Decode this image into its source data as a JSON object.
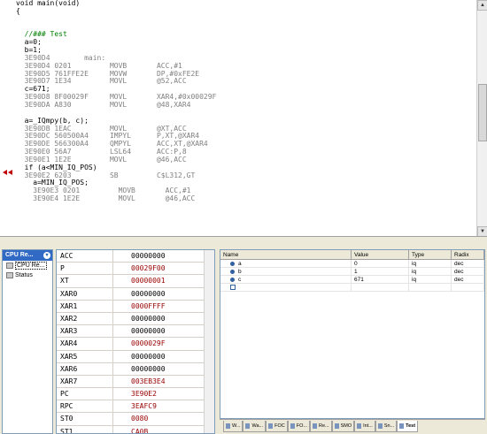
{
  "code_lines": [
    {
      "text": "void main(void)",
      "cls": "c-src"
    },
    {
      "text": "{",
      "cls": "c-src"
    },
    {
      "text": "",
      "cls": "c-src"
    },
    {
      "text": "",
      "cls": "c-src"
    },
    {
      "text": "  //### Test",
      "cls": "c-comment"
    },
    {
      "text": "  a=0;",
      "cls": "c-src"
    },
    {
      "text": "  b=1;",
      "cls": "c-src"
    },
    {
      "text": "  3E90D4        main:",
      "cls": "c-asm"
    },
    {
      "text": "  3E90D4 0201         MOVB       ACC,#1",
      "cls": "c-asm"
    },
    {
      "text": "  3E90D5 761FFE2E     MOVW       DP,#0xFE2E",
      "cls": "c-asm"
    },
    {
      "text": "  3E90D7 1E34         MOVL       @52,ACC",
      "cls": "c-asm"
    },
    {
      "text": "  c=671;",
      "cls": "c-src"
    },
    {
      "text": "  3E90D8 8F00029F     MOVL       XAR4,#0x00029F",
      "cls": "c-asm"
    },
    {
      "text": "  3E90DA A830         MOVL       @48,XAR4",
      "cls": "c-asm"
    },
    {
      "text": "",
      "cls": "c-src"
    },
    {
      "text": "  a=_IQmpy(b, c);",
      "cls": "c-src"
    },
    {
      "text": "  3E90DB 1EAC         MOVL       @XT,ACC",
      "cls": "c-asm"
    },
    {
      "text": "  3E90DC 560500A4     IMPYL      P,XT,@XAR4",
      "cls": "c-asm"
    },
    {
      "text": "  3E90DE 566300A4     QMPYL      ACC,XT,@XAR4",
      "cls": "c-asm"
    },
    {
      "text": "  3E90E0 56A7         LSL64      ACC:P,8",
      "cls": "c-asm"
    },
    {
      "text": "  3E90E1 1E2E         MOVL       @46,ACC",
      "cls": "c-asm"
    },
    {
      "text": "  if (a<MIN_IQ_POS)",
      "cls": "c-src"
    },
    {
      "text": "  3E90E2 6203         SB         C$L312,GT",
      "cls": "c-asm"
    },
    {
      "text": "    a=MIN_IQ_POS;",
      "cls": "c-src"
    },
    {
      "text": "    3E90E3 0201         MOVB       ACC,#1",
      "cls": "c-asm"
    },
    {
      "text": "    3E90E4 1E2E         MOVL       @46,ACC",
      "cls": "c-asm"
    }
  ],
  "tree": {
    "header": "CPU Re...",
    "items": [
      {
        "label": "CPU Re...",
        "selected": true
      },
      {
        "label": "Status",
        "selected": false
      }
    ]
  },
  "registers": [
    {
      "name": "ACC",
      "value": "00000000",
      "color": "black"
    },
    {
      "name": "P",
      "value": "00029F00",
      "color": "red"
    },
    {
      "name": "XT",
      "value": "00000001",
      "color": "red"
    },
    {
      "name": "XAR0",
      "value": "00000000",
      "color": "black"
    },
    {
      "name": "XAR1",
      "value": "0000FFFF",
      "color": "red"
    },
    {
      "name": "XAR2",
      "value": "00000000",
      "color": "black"
    },
    {
      "name": "XAR3",
      "value": "00000000",
      "color": "black"
    },
    {
      "name": "XAR4",
      "value": "0000029F",
      "color": "red"
    },
    {
      "name": "XAR5",
      "value": "00000000",
      "color": "black"
    },
    {
      "name": "XAR6",
      "value": "00000000",
      "color": "black"
    },
    {
      "name": "XAR7",
      "value": "003EB3E4",
      "color": "red"
    },
    {
      "name": "PC",
      "value": "3E90E2",
      "color": "red"
    },
    {
      "name": "RPC",
      "value": "3EAFC9",
      "color": "red"
    },
    {
      "name": "ST0",
      "value": "0080",
      "color": "red"
    },
    {
      "name": "ST1",
      "value": "CA0B",
      "color": "red"
    }
  ],
  "watch": {
    "headers": {
      "name": "Name",
      "value": "Value",
      "type": "Type",
      "radix": "Radix"
    },
    "rows": [
      {
        "name": "a",
        "value": "0",
        "type": "iq",
        "radix": "dec"
      },
      {
        "name": "b",
        "value": "1",
        "type": "iq",
        "radix": "dec"
      },
      {
        "name": "c",
        "value": "671",
        "type": "iq",
        "radix": "dec"
      }
    ]
  },
  "tabs": [
    {
      "label": "W...",
      "active": false
    },
    {
      "label": "Wa...",
      "active": false
    },
    {
      "label": "FOC",
      "active": false
    },
    {
      "label": "FO...",
      "active": false
    },
    {
      "label": "Re...",
      "active": false
    },
    {
      "label": "SMO",
      "active": false
    },
    {
      "label": "Int...",
      "active": false
    },
    {
      "label": "Sn...",
      "active": false
    },
    {
      "label": "Test",
      "active": true
    }
  ]
}
